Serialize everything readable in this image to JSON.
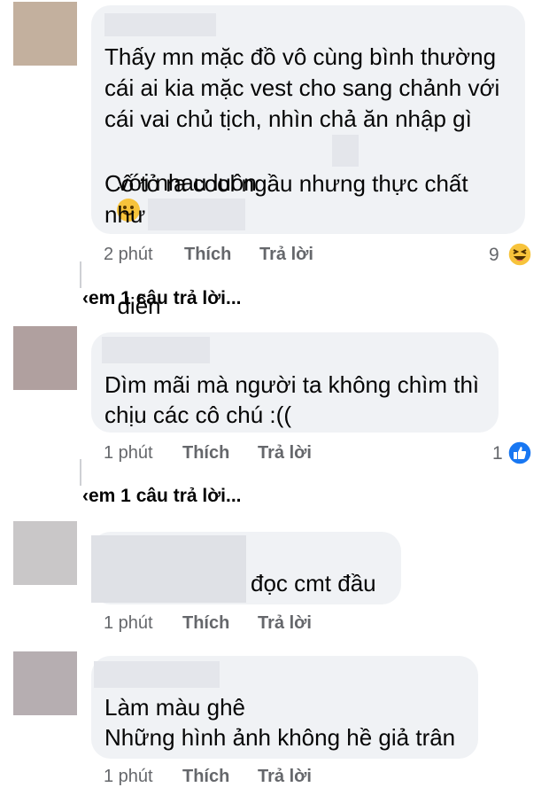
{
  "comments": [
    {
      "lines": [
        "Thấy mn mặc đồ vô cùng bình thường",
        "cái ai kia mặc vest cho sang chảnh với",
        "cái vai chủ tịch, nhìn chả ăn nhập gì",
        "với nhau luôn",
        "diễn",
        "Cố tỏ ra cool ngầu nhưng thực chất",
        "như"
      ],
      "emoji_name": "smile-emoji-icon",
      "time": "2 phút",
      "like": "Thích",
      "reply": "Trả lời",
      "reaction_count": "9",
      "reaction_icon": "haha-reaction-icon",
      "avatar_color": "#c3b09e"
    },
    {
      "lines": [
        "Dìm mãi mà người ta không chìm thì",
        "chịu các cô chú :(("
      ],
      "time": "1 phút",
      "like": "Thích",
      "reply": "Trả lời",
      "reaction_count": "1",
      "reaction_icon": "like-reaction-icon",
      "avatar_color": "#b0a09f"
    },
    {
      "lines": [
        "đọc cmt đầu"
      ],
      "time": "1 phút",
      "like": "Thích",
      "reply": "Trả lời",
      "avatar_color": "#c9c7c8"
    },
    {
      "lines": [
        "Làm màu ghê",
        "Những hình ảnh không hề giả trân"
      ],
      "time": "1 phút",
      "like": "Thích",
      "reply": "Trả lời",
      "avatar_color": "#b6aeb1"
    }
  ],
  "view_more": [
    "‹em 1 câu trả lời...",
    "‹em 1 câu trả lời..."
  ],
  "colors": {
    "bubble": "#f0f2f5",
    "meta": "#65676b",
    "like_blue": "#1877f2",
    "haha_yellow": "#f7c33b"
  }
}
